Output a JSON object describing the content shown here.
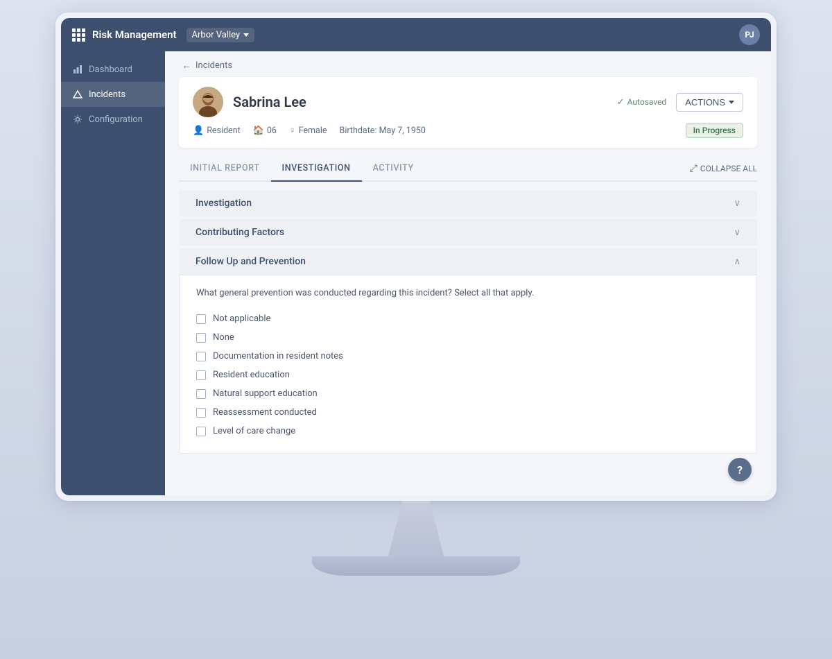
{
  "app": {
    "title": "Risk Management",
    "org": "Arbor Valley",
    "avatar_initials": "PJ"
  },
  "sidebar": {
    "items": [
      {
        "id": "dashboard",
        "label": "Dashboard",
        "icon": "bar-chart-icon",
        "active": false
      },
      {
        "id": "incidents",
        "label": "Incidents",
        "icon": "triangle-icon",
        "active": true
      },
      {
        "id": "configuration",
        "label": "Configuration",
        "icon": "gear-icon",
        "active": false
      }
    ]
  },
  "breadcrumb": {
    "back_label": "Incidents"
  },
  "patient": {
    "name": "Sabrina Lee",
    "role": "Resident",
    "room": "06",
    "gender": "Female",
    "birthdate": "Birthdate: May 7, 1950",
    "autosaved_label": "Autosaved",
    "actions_label": "ACTIONS",
    "status": "In Progress"
  },
  "tabs": [
    {
      "id": "initial-report",
      "label": "INITIAL REPORT",
      "active": false
    },
    {
      "id": "investigation",
      "label": "INVESTIGATION",
      "active": true
    },
    {
      "id": "activity",
      "label": "ACTIVITY",
      "active": false
    }
  ],
  "collapse_all_label": "COLLAPSE ALL",
  "sections": [
    {
      "id": "investigation",
      "label": "Investigation",
      "expanded": false
    },
    {
      "id": "contributing-factors",
      "label": "Contributing Factors",
      "expanded": false
    },
    {
      "id": "follow-up",
      "label": "Follow Up and Prevention",
      "expanded": true
    }
  ],
  "followup": {
    "question": "What general prevention was conducted regarding this incident? Select all that apply.",
    "checkboxes": [
      {
        "id": "not-applicable",
        "label": "Not applicable",
        "checked": false
      },
      {
        "id": "none",
        "label": "None",
        "checked": false
      },
      {
        "id": "documentation",
        "label": "Documentation in resident notes",
        "checked": false
      },
      {
        "id": "resident-education",
        "label": "Resident education",
        "checked": false
      },
      {
        "id": "natural-support",
        "label": "Natural support education",
        "checked": false
      },
      {
        "id": "reassessment",
        "label": "Reassessment conducted",
        "checked": false
      },
      {
        "id": "level-of-care",
        "label": "Level of care change",
        "checked": false
      }
    ]
  }
}
